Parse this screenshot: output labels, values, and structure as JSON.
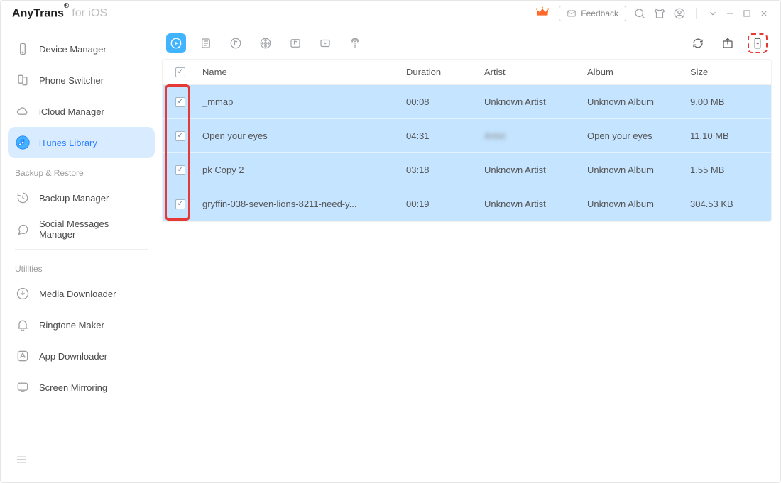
{
  "title": {
    "brand": "AnyTrans",
    "reg": "®",
    "suffix": "for iOS"
  },
  "topbar": {
    "feedback_label": "Feedback"
  },
  "sidebar": {
    "items": [
      {
        "label": "Device Manager"
      },
      {
        "label": "Phone Switcher"
      },
      {
        "label": "iCloud Manager"
      },
      {
        "label": "iTunes Library"
      }
    ],
    "heading_backup": "Backup & Restore",
    "backup_items": [
      {
        "label": "Backup Manager"
      },
      {
        "label": "Social Messages Manager"
      }
    ],
    "heading_utilities": "Utilities",
    "utilities_items": [
      {
        "label": "Media Downloader"
      },
      {
        "label": "Ringtone Maker"
      },
      {
        "label": "App Downloader"
      },
      {
        "label": "Screen Mirroring"
      }
    ]
  },
  "columns": {
    "name": "Name",
    "duration": "Duration",
    "artist": "Artist",
    "album": "Album",
    "size": "Size"
  },
  "rows": [
    {
      "name": "_mmap",
      "duration": "00:08",
      "artist": "Unknown Artist",
      "album": "Unknown Album",
      "size": "9.00 MB",
      "blurArtist": false
    },
    {
      "name": "Open your eyes",
      "duration": "04:31",
      "artist": "Artist",
      "album": "Open your eyes",
      "size": "11.10 MB",
      "blurArtist": true
    },
    {
      "name": "pk Copy 2",
      "duration": "03:18",
      "artist": "Unknown Artist",
      "album": "Unknown Album",
      "size": "1.55 MB",
      "blurArtist": false
    },
    {
      "name": "gryffin-038-seven-lions-8211-need-y...",
      "duration": "00:19",
      "artist": "Unknown Artist",
      "album": "Unknown Album",
      "size": "304.53 KB",
      "blurArtist": false
    }
  ]
}
